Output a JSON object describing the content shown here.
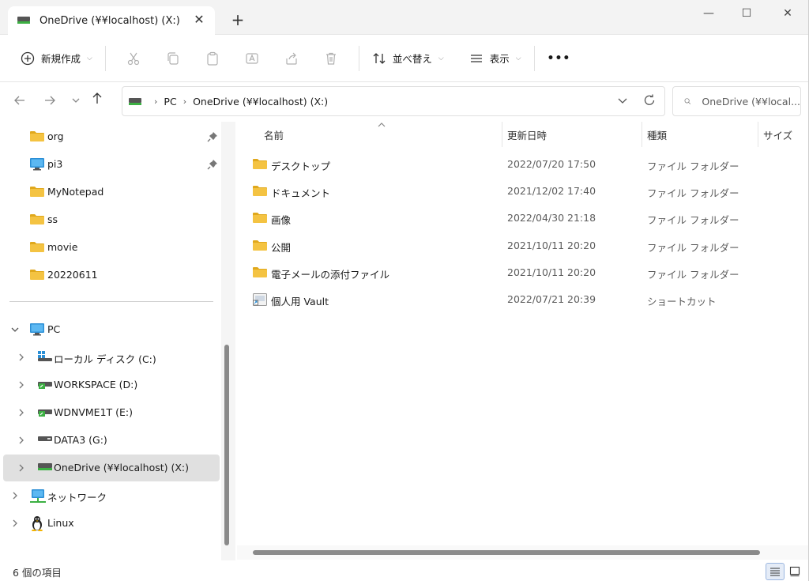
{
  "window": {
    "tab_title": "OneDrive (¥¥localhost) (X:)",
    "close_tab_glyph": "✕",
    "new_tab_glyph": "+",
    "minimize_glyph": "—",
    "maximize_glyph": "☐",
    "close_glyph": "✕"
  },
  "toolbar": {
    "new_label": "新規作成",
    "sort_label": "並べ替え",
    "view_label": "表示",
    "more_glyph": "•••",
    "dropdown_glyph": "⌵"
  },
  "address": {
    "crumbs": [
      "PC",
      "OneDrive (¥¥localhost) (X:)"
    ],
    "separator": "›",
    "search_placeholder": "OneDrive (¥¥local..."
  },
  "nav": {
    "quick": [
      {
        "label": "org",
        "icon": "folder-icon",
        "pinned": true
      },
      {
        "label": "pi3",
        "icon": "monitor-icon",
        "pinned": true
      },
      {
        "label": "MyNotepad",
        "icon": "folder-icon",
        "pinned": false
      },
      {
        "label": "ss",
        "icon": "folder-icon",
        "pinned": false
      },
      {
        "label": "movie",
        "icon": "folder-icon",
        "pinned": false
      },
      {
        "label": "20220611",
        "icon": "folder-icon",
        "pinned": false
      }
    ],
    "pc_label": "PC",
    "drives": [
      {
        "label": "ローカル ディスク (C:)",
        "icon": "windows-drive-icon",
        "selected": false
      },
      {
        "label": "WORKSPACE (D:)",
        "icon": "network-drive-icon",
        "selected": false
      },
      {
        "label": "WDNVME1T (E:)",
        "icon": "network-drive-icon",
        "selected": false
      },
      {
        "label": "DATA3 (G:)",
        "icon": "drive-icon",
        "selected": false
      },
      {
        "label": "OneDrive (¥¥localhost) (X:)",
        "icon": "mapped-drive-icon",
        "selected": true
      }
    ],
    "network_label": "ネットワーク",
    "linux_label": "Linux"
  },
  "files": {
    "columns": {
      "name": "名前",
      "date": "更新日時",
      "type": "種類",
      "size": "サイズ"
    },
    "rows": [
      {
        "name": "デスクトップ",
        "date": "2022/07/20 17:50",
        "type": "ファイル フォルダー",
        "icon": "folder-icon"
      },
      {
        "name": "ドキュメント",
        "date": "2021/12/02 17:40",
        "type": "ファイル フォルダー",
        "icon": "folder-icon"
      },
      {
        "name": "画像",
        "date": "2022/04/30 21:18",
        "type": "ファイル フォルダー",
        "icon": "folder-icon"
      },
      {
        "name": "公開",
        "date": "2021/10/11 20:20",
        "type": "ファイル フォルダー",
        "icon": "folder-icon"
      },
      {
        "name": "電子メールの添付ファイル",
        "date": "2021/10/11 20:20",
        "type": "ファイル フォルダー",
        "icon": "folder-icon"
      },
      {
        "name": "個人用 Vault",
        "date": "2022/07/21 20:39",
        "type": "ショートカット",
        "icon": "shortcut-icon"
      }
    ]
  },
  "status": {
    "item_count": "6 個の項目"
  },
  "colors": {
    "folder": "#f4c342",
    "folder_dark": "#e0a81c",
    "selected_bg": "#e0e0e0",
    "drive_green": "#3cb043",
    "monitor_blue": "#2b8fd6"
  }
}
